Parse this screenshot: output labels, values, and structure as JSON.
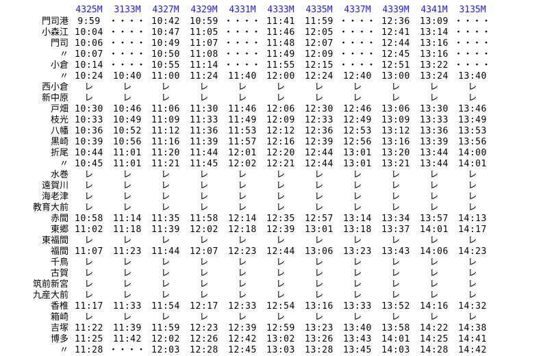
{
  "trains": [
    "4325M",
    "3133M",
    "4327M",
    "4329M",
    "4331M",
    "4333M",
    "4335M",
    "4337M",
    "4339M",
    "4341M",
    "3135M"
  ],
  "rows": [
    {
      "station": "門司港",
      "times": [
        "9:59",
        "・・・・",
        "10:42",
        "10:59",
        "・・・・",
        "11:41",
        "11:59",
        "・・・・",
        "12:36",
        "13:09",
        "・・・・"
      ]
    },
    {
      "station": "小森江",
      "times": [
        "10:04",
        "・・・・",
        "10:47",
        "11:05",
        "・・・・",
        "11:46",
        "12:05",
        "・・・・",
        "12:41",
        "13:14",
        "・・・・"
      ]
    },
    {
      "station": "門司",
      "times": [
        "10:06",
        "・・・・",
        "10:49",
        "11:07",
        "・・・・",
        "11:48",
        "12:07",
        "・・・・",
        "12:44",
        "13:16",
        "・・・・"
      ]
    },
    {
      "station": "〃",
      "times": [
        "10:07",
        "・・・・",
        "10:50",
        "11:08",
        "・・・・",
        "11:49",
        "12:09",
        "・・・・",
        "12:45",
        "13:16",
        "・・・・"
      ]
    },
    {
      "station": "小倉",
      "times": [
        "10:14",
        "・・・・",
        "10:55",
        "11:14",
        "・・・・",
        "11:55",
        "12:15",
        "・・・・",
        "12:51",
        "13:22",
        "・・・・"
      ]
    },
    {
      "station": "〃",
      "times": [
        "10:24",
        "10:40",
        "11:00",
        "11:24",
        "11:40",
        "12:00",
        "12:24",
        "12:40",
        "13:00",
        "13:24",
        "13:40"
      ]
    },
    {
      "station": "西小倉",
      "times": [
        "レ",
        "レ",
        "レ",
        "レ",
        "レ",
        "レ",
        "レ",
        "レ",
        "レ",
        "レ",
        "レ"
      ]
    },
    {
      "station": "新中原",
      "times": [
        "レ",
        "レ",
        "レ",
        "レ",
        "レ",
        "レ",
        "レ",
        "レ",
        "レ",
        "レ",
        "レ"
      ]
    },
    {
      "station": "戸畑",
      "times": [
        "10:30",
        "10:46",
        "11:06",
        "11:30",
        "11:46",
        "12:06",
        "12:30",
        "12:46",
        "13:06",
        "13:30",
        "13:46"
      ]
    },
    {
      "station": "枝光",
      "times": [
        "10:33",
        "10:49",
        "11:09",
        "11:33",
        "11:49",
        "12:09",
        "12:33",
        "12:49",
        "13:09",
        "13:33",
        "13:49"
      ]
    },
    {
      "station": "八幡",
      "times": [
        "10:36",
        "10:52",
        "11:12",
        "11:36",
        "11:53",
        "12:12",
        "12:36",
        "12:53",
        "13:12",
        "13:36",
        "13:53"
      ]
    },
    {
      "station": "黒崎",
      "times": [
        "10:39",
        "10:56",
        "11:16",
        "11:39",
        "11:57",
        "12:16",
        "12:39",
        "12:56",
        "13:16",
        "13:39",
        "13:56"
      ]
    },
    {
      "station": "折尾",
      "times": [
        "10:44",
        "11:01",
        "11:20",
        "11:44",
        "12:01",
        "12:20",
        "12:44",
        "13:01",
        "13:20",
        "13:44",
        "14:00"
      ]
    },
    {
      "station": "〃",
      "times": [
        "10:45",
        "11:01",
        "11:21",
        "11:45",
        "12:02",
        "12:21",
        "12:44",
        "13:01",
        "13:21",
        "13:44",
        "14:01"
      ]
    },
    {
      "station": "水巻",
      "times": [
        "レ",
        "レ",
        "レ",
        "レ",
        "レ",
        "レ",
        "レ",
        "レ",
        "レ",
        "レ",
        "レ"
      ]
    },
    {
      "station": "遠賀川",
      "times": [
        "レ",
        "レ",
        "レ",
        "レ",
        "レ",
        "レ",
        "レ",
        "レ",
        "レ",
        "レ",
        "レ"
      ]
    },
    {
      "station": "海老津",
      "times": [
        "レ",
        "レ",
        "レ",
        "レ",
        "レ",
        "レ",
        "レ",
        "レ",
        "レ",
        "レ",
        "レ"
      ]
    },
    {
      "station": "教育大前",
      "times": [
        "レ",
        "レ",
        "レ",
        "レ",
        "レ",
        "レ",
        "レ",
        "レ",
        "レ",
        "レ",
        "レ"
      ]
    },
    {
      "station": "赤間",
      "times": [
        "10:58",
        "11:14",
        "11:35",
        "11:58",
        "12:14",
        "12:35",
        "12:57",
        "13:14",
        "13:34",
        "13:57",
        "14:13"
      ]
    },
    {
      "station": "東郷",
      "times": [
        "11:02",
        "11:18",
        "11:39",
        "12:02",
        "12:18",
        "12:39",
        "13:01",
        "13:18",
        "13:37",
        "14:01",
        "14:17"
      ]
    },
    {
      "station": "東福間",
      "times": [
        "レ",
        "レ",
        "レ",
        "レ",
        "レ",
        "レ",
        "レ",
        "レ",
        "レ",
        "レ",
        "レ"
      ]
    },
    {
      "station": "福間",
      "times": [
        "11:07",
        "11:23",
        "11:44",
        "12:07",
        "12:23",
        "12:44",
        "13:06",
        "13:23",
        "13:43",
        "14:06",
        "14:23"
      ]
    },
    {
      "station": "千鳥",
      "times": [
        "レ",
        "レ",
        "レ",
        "レ",
        "レ",
        "レ",
        "レ",
        "レ",
        "レ",
        "レ",
        "レ"
      ]
    },
    {
      "station": "古賀",
      "times": [
        "レ",
        "レ",
        "レ",
        "レ",
        "レ",
        "レ",
        "レ",
        "レ",
        "レ",
        "レ",
        "レ"
      ]
    },
    {
      "station": "筑前新宮",
      "times": [
        "レ",
        "レ",
        "レ",
        "レ",
        "レ",
        "レ",
        "レ",
        "レ",
        "レ",
        "レ",
        "レ"
      ]
    },
    {
      "station": "九産大前",
      "times": [
        "レ",
        "レ",
        "レ",
        "レ",
        "レ",
        "レ",
        "レ",
        "レ",
        "レ",
        "レ",
        "レ"
      ]
    },
    {
      "station": "香椎",
      "times": [
        "11:17",
        "11:33",
        "11:54",
        "12:17",
        "12:33",
        "12:54",
        "13:16",
        "13:33",
        "13:52",
        "14:16",
        "14:32"
      ]
    },
    {
      "station": "箱崎",
      "times": [
        "レ",
        "レ",
        "レ",
        "レ",
        "レ",
        "レ",
        "レ",
        "レ",
        "レ",
        "レ",
        "レ"
      ]
    },
    {
      "station": "吉塚",
      "times": [
        "11:22",
        "11:39",
        "11:59",
        "12:23",
        "12:39",
        "12:59",
        "13:23",
        "13:40",
        "13:58",
        "14:22",
        "14:38"
      ]
    },
    {
      "station": "博多",
      "times": [
        "11:25",
        "11:42",
        "12:02",
        "12:26",
        "12:42",
        "13:02",
        "13:26",
        "13:43",
        "14:01",
        "14:25",
        "14:41"
      ]
    },
    {
      "station": "〃",
      "times": [
        "11:28",
        "・・・・",
        "12:03",
        "12:28",
        "12:45",
        "13:03",
        "13:28",
        "13:45",
        "14:03",
        "14:28",
        "14:42"
      ]
    }
  ]
}
